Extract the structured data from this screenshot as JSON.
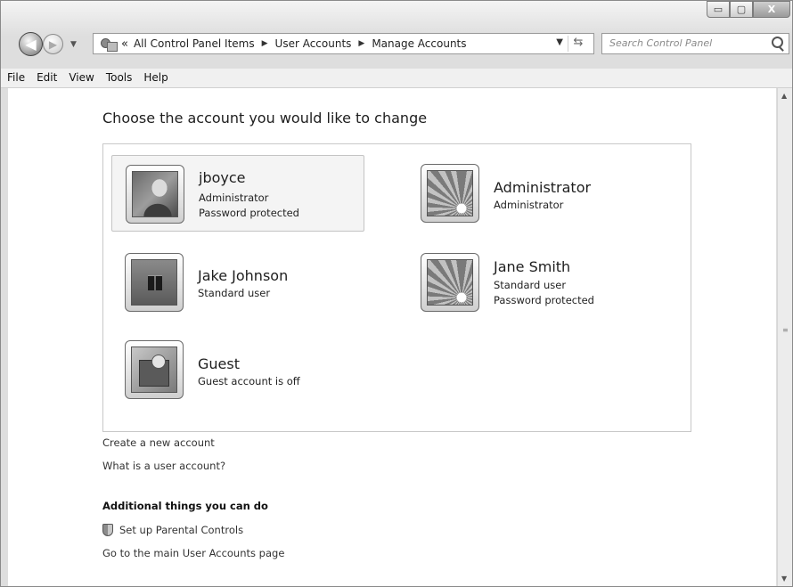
{
  "window": {
    "controls": {
      "minimize": "▭",
      "maximize": "▢",
      "close": "X"
    }
  },
  "nav": {
    "back_icon": "arrow-left-icon",
    "forward_icon": "arrow-right-icon",
    "chevrons": "«",
    "breadcrumbs": [
      "All Control Panel Items",
      "User Accounts",
      "Manage Accounts"
    ],
    "search_placeholder": "Search Control Panel"
  },
  "menu": [
    "File",
    "Edit",
    "View",
    "Tools",
    "Help"
  ],
  "main": {
    "heading": "Choose the account you would like to change",
    "accounts": [
      {
        "name": "jboyce",
        "lines": [
          "Administrator",
          "Password protected"
        ],
        "picture": "photo",
        "selected": true
      },
      {
        "name": "Administrator",
        "lines": [
          "Administrator"
        ],
        "picture": "flower",
        "selected": false
      },
      {
        "name": "Jake Johnson",
        "lines": [
          "Standard user"
        ],
        "picture": "chess",
        "selected": false
      },
      {
        "name": "Jane Smith",
        "lines": [
          "Standard user",
          "Password protected"
        ],
        "picture": "flower",
        "selected": false
      },
      {
        "name": "Guest",
        "lines": [
          "Guest account is off"
        ],
        "picture": "guest",
        "selected": false
      }
    ],
    "links": [
      "Create a new account",
      "What is a user account?"
    ],
    "additional_heading": "Additional things you can do",
    "additional_links": [
      "Set up Parental Controls",
      "Go to the main User Accounts page"
    ]
  }
}
